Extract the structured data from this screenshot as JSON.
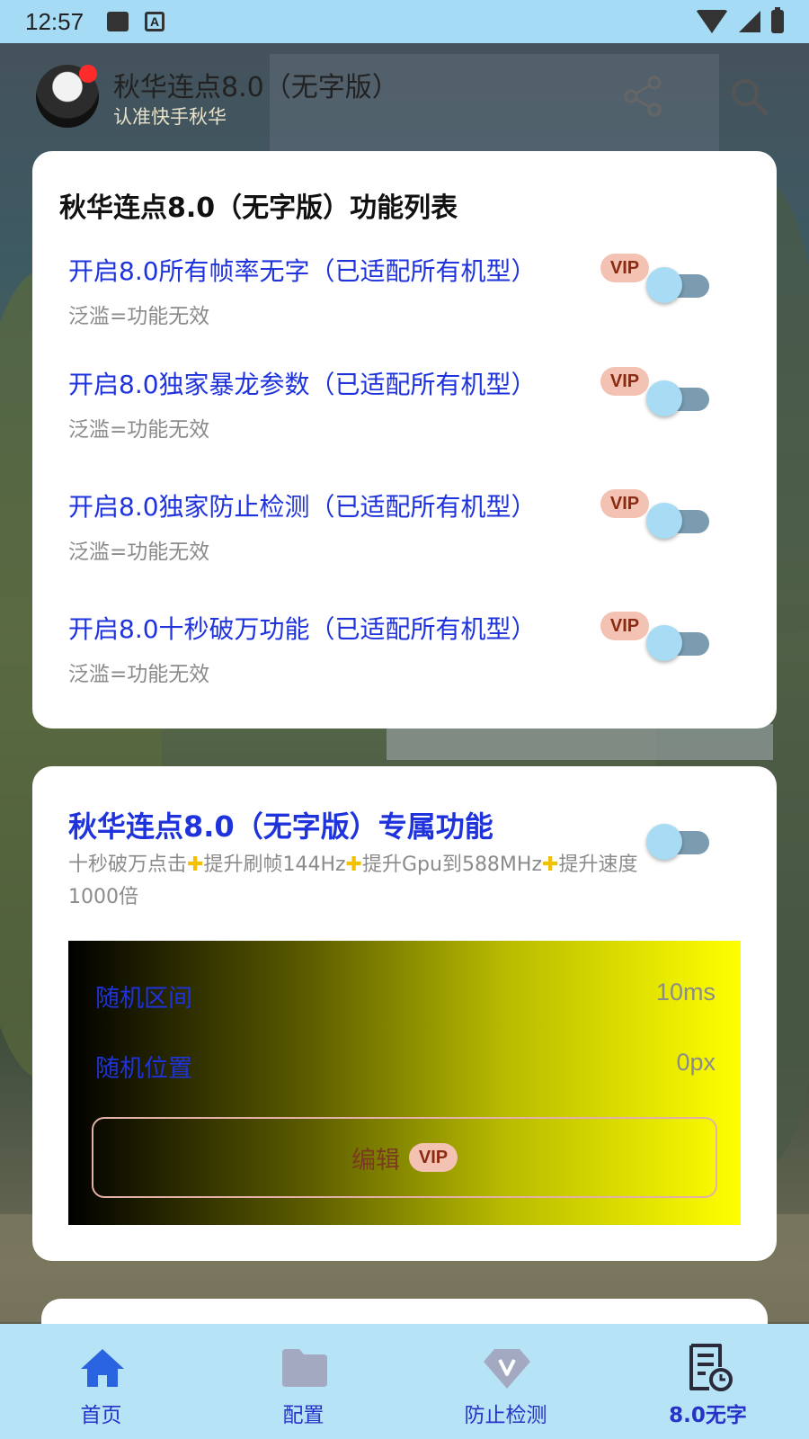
{
  "status_bar": {
    "time": "12:57"
  },
  "app_bar": {
    "title": "秋华连点8.0（无字版）",
    "subtitle": "认准快手秋华"
  },
  "feature_list": {
    "title": "秋华连点8.0（无字版）功能列表",
    "items": [
      {
        "label": "开启8.0所有帧率无字（已适配所有机型）",
        "badge": "VIP",
        "subtitle": "泛滥=功能无效",
        "enabled": false
      },
      {
        "label": "开启8.0独家暴龙参数（已适配所有机型）",
        "badge": "VIP",
        "subtitle": "泛滥=功能无效",
        "enabled": false
      },
      {
        "label": "开启8.0独家防止检测（已适配所有机型）",
        "badge": "VIP",
        "subtitle": "泛滥=功能无效",
        "enabled": false
      },
      {
        "label": "开启8.0十秒破万功能（已适配所有机型）",
        "badge": "VIP",
        "subtitle": "泛滥=功能无效",
        "enabled": false
      }
    ]
  },
  "exclusive": {
    "title": "秋华连点8.0（无字版）专属功能",
    "desc_parts": [
      "十秒破万点击",
      "提升刷帧144Hz",
      "提升Gpu到588MHz",
      "提升速度1000倍"
    ],
    "enabled": false,
    "random_interval": {
      "label": "随机区间",
      "value": "10ms"
    },
    "random_position": {
      "label": "随机位置",
      "value": "0px"
    },
    "edit_button": {
      "label": "编辑",
      "badge": "VIP"
    }
  },
  "bottom_nav": {
    "items": [
      {
        "label": "首页",
        "icon": "home-icon"
      },
      {
        "label": "配置",
        "icon": "folder-icon"
      },
      {
        "label": "防止检测",
        "icon": "vip-diamond-icon"
      },
      {
        "label": "8.0无字",
        "icon": "document-clock-icon"
      }
    ],
    "active_index": 3
  },
  "colors": {
    "status_bar": "#a6dbf5",
    "accent_text": "#1f33dd",
    "vip_badge_bg": "#f3c2b3",
    "bottom_nav_bg": "#b7e3f7"
  }
}
